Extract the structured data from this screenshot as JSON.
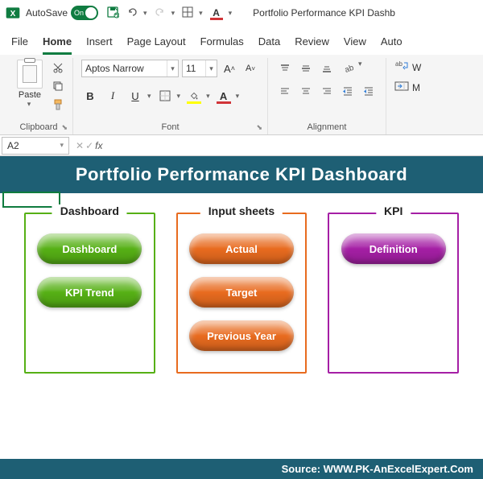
{
  "titlebar": {
    "autosave_label": "AutoSave",
    "autosave_state": "On",
    "window_title": "Portfolio Performance KPI Dashb"
  },
  "tabs": {
    "file": "File",
    "home": "Home",
    "insert": "Insert",
    "page_layout": "Page Layout",
    "formulas": "Formulas",
    "data": "Data",
    "review": "Review",
    "view": "View",
    "automate": "Auto"
  },
  "ribbon": {
    "clipboard": {
      "label": "Clipboard",
      "paste": "Paste"
    },
    "font": {
      "label": "Font",
      "name": "Aptos Narrow",
      "size": "11",
      "bold": "B",
      "italic": "I",
      "underline": "U"
    },
    "alignment": {
      "label": "Alignment",
      "wrap": "W",
      "merge": "M"
    }
  },
  "fxbar": {
    "cell": "A2",
    "fx_label": "fx",
    "value": ""
  },
  "dashboard": {
    "title": "Portfolio Performance KPI Dashboard",
    "panels": [
      {
        "title": "Dashboard",
        "color": "green",
        "buttons": [
          "Dashboard",
          "KPI Trend"
        ]
      },
      {
        "title": "Input sheets",
        "color": "orange",
        "buttons": [
          "Actual",
          "Target",
          "Previous Year"
        ]
      },
      {
        "title": "KPI",
        "color": "purple",
        "buttons": [
          "Definition"
        ]
      }
    ],
    "source": "Source: WWW.PK-AnExcelExpert.Com"
  }
}
